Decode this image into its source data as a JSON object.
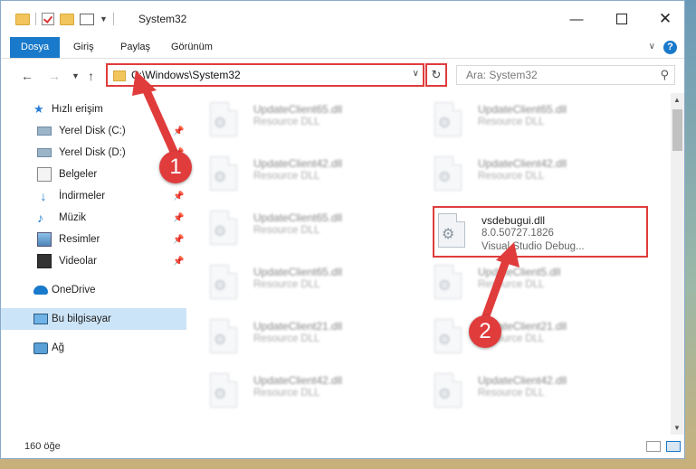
{
  "window": {
    "title": "System32"
  },
  "ribbon": {
    "tabs": [
      "Dosya",
      "Giriş",
      "Paylaş",
      "Görünüm"
    ],
    "active_tab": "Dosya",
    "help_label": "?"
  },
  "nav": {
    "address": "C:\\Windows\\System32",
    "search_placeholder": "Ara: System32"
  },
  "sidebar": {
    "quick_access": "Hızlı erişim",
    "items": [
      {
        "label": "Yerel Disk (C:)",
        "icon": "drive-icon",
        "pinned": true
      },
      {
        "label": "Yerel Disk (D:)",
        "icon": "drive-icon",
        "pinned": true
      },
      {
        "label": "Belgeler",
        "icon": "documents-icon",
        "pinned": true
      },
      {
        "label": "İndirmeler",
        "icon": "download-icon",
        "pinned": true
      },
      {
        "label": "Müzik",
        "icon": "music-icon",
        "pinned": true
      },
      {
        "label": "Resimler",
        "icon": "pictures-icon",
        "pinned": true
      },
      {
        "label": "Videolar",
        "icon": "videos-icon",
        "pinned": true
      }
    ],
    "onedrive": "OneDrive",
    "this_pc": "Bu bilgisayar",
    "network": "Ağ"
  },
  "files": [
    {
      "name": "UpdateClient65.dll",
      "type": "Resource DLL"
    },
    {
      "name": "UpdateClient65.dll",
      "type": "Resource DLL"
    },
    {
      "name": "UpdateClient42.dll",
      "type": "Resource DLL"
    },
    {
      "name": "UpdateClient42.dll",
      "type": "Resource DLL"
    },
    {
      "name": "UpdateClient65.dll",
      "type": "Resource DLL"
    },
    {
      "name": "UpdateClient65.dll",
      "type": "Resource DLL"
    },
    {
      "name": "UpdateClient5.dll",
      "type": "Resource DLL"
    },
    {
      "name": "UpdateClient21.dll",
      "type": "Resource DLL"
    },
    {
      "name": "UpdateClient21.dll",
      "type": "Resource DLL"
    },
    {
      "name": "UpdateClient42.dll",
      "type": "Resource DLL"
    },
    {
      "name": "UpdateClient42.dll",
      "type": "Resource DLL"
    }
  ],
  "highlighted_file": {
    "name": "vsdebugui.dll",
    "version": "8.0.50727.1826",
    "description": "Visual Studio Debug..."
  },
  "status": {
    "item_count": "160 öğe"
  },
  "annotations": {
    "step1": "1",
    "step2": "2",
    "color": "#e03c3c"
  }
}
